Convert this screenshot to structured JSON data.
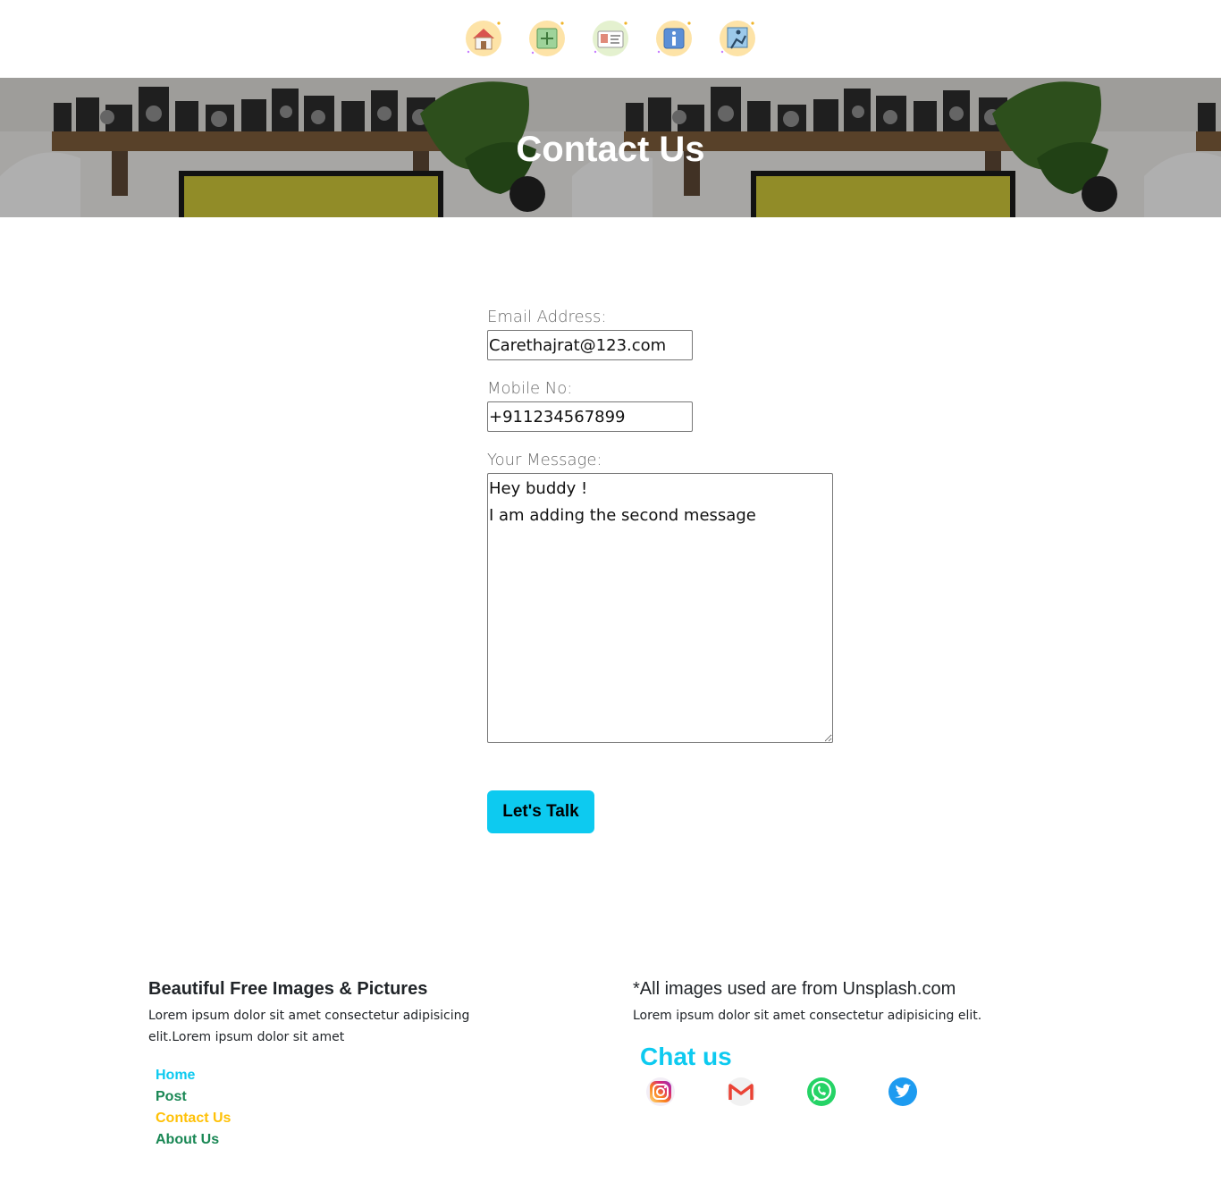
{
  "nav": {
    "icons": [
      {
        "name": "home-icon",
        "target": "Home"
      },
      {
        "name": "add-post-icon",
        "target": "Post"
      },
      {
        "name": "contact-card-icon",
        "target": "Contact Us"
      },
      {
        "name": "info-icon",
        "target": "About Us"
      },
      {
        "name": "user-activity-icon",
        "target": ""
      }
    ]
  },
  "hero": {
    "title": "Contact Us"
  },
  "form": {
    "email_label": "Email Address:",
    "email_value": "Carethajrat@123.com",
    "mobile_label": "Mobile No:",
    "mobile_value": "+911234567899",
    "message_label": "Your Message:",
    "message_lines": [
      "Hey buddy !",
      "I am adding the second message"
    ],
    "submit_label": "Let's Talk"
  },
  "footer": {
    "left": {
      "heading": "Beautiful Free Images & Pictures",
      "text": "Lorem ipsum dolor sit amet consectetur adipisicing elit.Lorem ipsum dolor sit amet",
      "links": [
        {
          "label": "Home",
          "color": "#0dcaf0"
        },
        {
          "label": "Post",
          "color": "#198754"
        },
        {
          "label": "Contact Us",
          "color": "#ffc107"
        },
        {
          "label": "About Us",
          "color": "#198754"
        }
      ]
    },
    "right": {
      "heading": "*All images used are from Unsplash.com",
      "text": "Lorem ipsum dolor sit amet consectetur adipisicing elit.",
      "chat_title": "Chat us",
      "social": [
        "instagram-icon",
        "gmail-icon",
        "whatsapp-icon",
        "twitter-icon"
      ]
    }
  },
  "colors": {
    "accent": "#0dcaf0",
    "success": "#198754",
    "warning": "#ffc107"
  }
}
